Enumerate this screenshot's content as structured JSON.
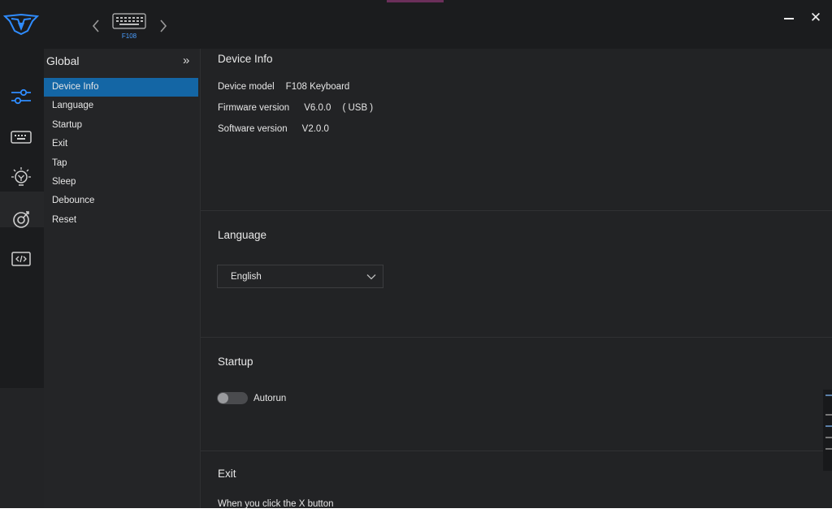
{
  "window": {
    "device_name": "F108",
    "icons": {
      "logo": "spider-logo-icon",
      "prev": "chevron-left-icon",
      "next": "chevron-right-icon",
      "device": "keyboard-thumbnail-icon",
      "minimize": "minimize-icon",
      "close": "close-icon"
    }
  },
  "iconbar": {
    "items": [
      {
        "name": "sliders-icon",
        "active": true
      },
      {
        "name": "keyboard-icon",
        "active": false
      },
      {
        "name": "lightbulb-icon",
        "active": false
      },
      {
        "name": "macro-icon",
        "active": false
      },
      {
        "name": "code-icon",
        "active": false
      }
    ]
  },
  "sidebar": {
    "title": "Global",
    "collapse_icon": "double-chevron-right-icon",
    "items": [
      "Device Info",
      "Language",
      "Startup",
      "Exit",
      "Tap",
      "Sleep",
      "Debounce",
      "Reset"
    ],
    "active_index": 0
  },
  "device_info": {
    "title": "Device Info",
    "model_label": "Device model",
    "model_value": "F108 Keyboard",
    "firmware_label": "Firmware version",
    "firmware_value": "V6.0.0",
    "firmware_extra": "( USB )",
    "software_label": "Software version",
    "software_value": "V2.0.0"
  },
  "language": {
    "title": "Language",
    "selected": "English"
  },
  "startup": {
    "title": "Startup",
    "autorun_label": "Autorun",
    "autorun_on": false
  },
  "exit": {
    "title": "Exit",
    "description": "When you click the X button"
  },
  "colors": {
    "accent": "#1466a5",
    "icon_blue": "#2f8cff"
  }
}
